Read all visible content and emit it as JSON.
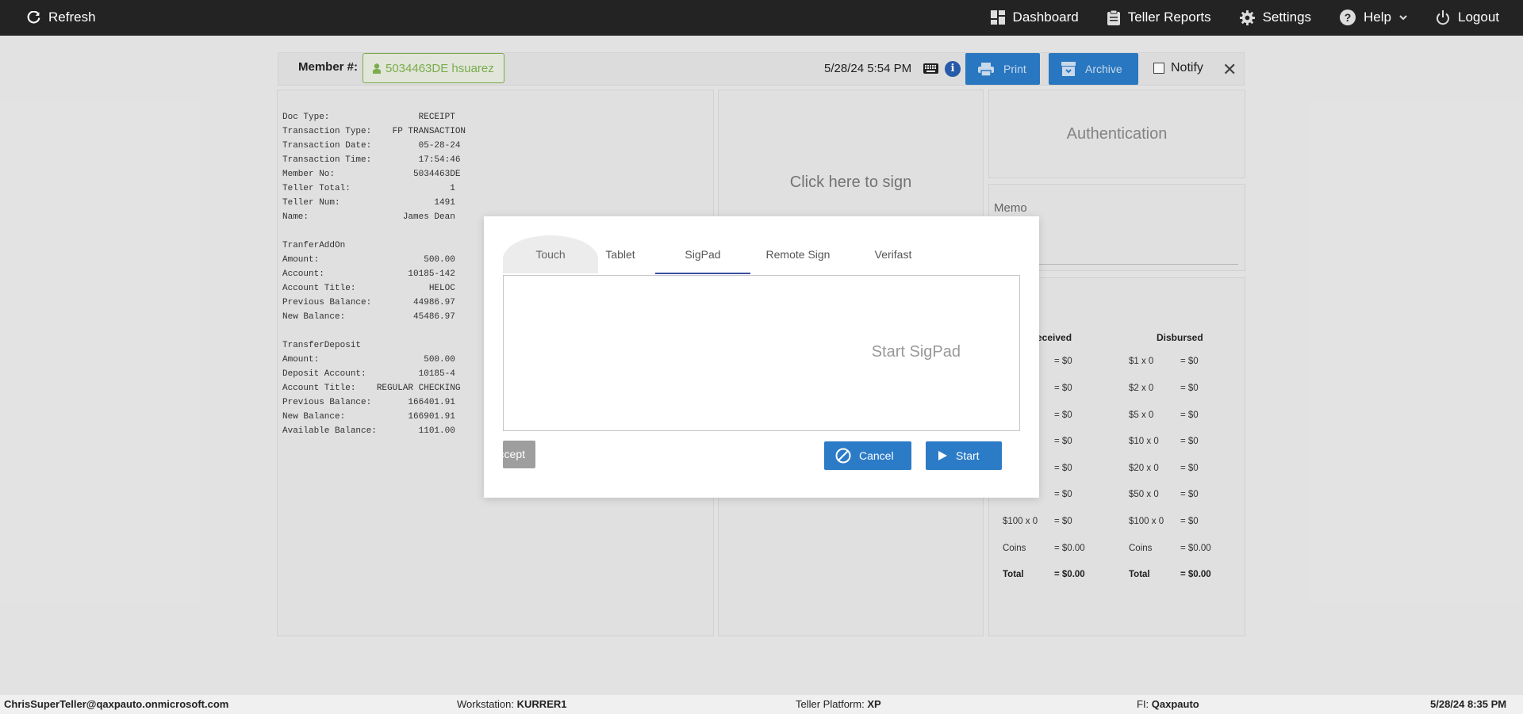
{
  "topbar": {
    "refresh_label": "Refresh",
    "nav": [
      {
        "label": "Dashboard",
        "icon": "dashboard-icon"
      },
      {
        "label": "Teller Reports",
        "icon": "clipboard-icon"
      },
      {
        "label": "Settings",
        "icon": "gear-icon"
      },
      {
        "label": "Help",
        "icon": "help-icon"
      },
      {
        "label": "Logout",
        "icon": "power-icon"
      }
    ]
  },
  "memberbar": {
    "label": "Member #:",
    "member": "5034463DE hsuarez",
    "datetime": "5/28/24 5:54 PM",
    "print_label": "Print",
    "archive_label": "Archive",
    "notify_label": "Notify"
  },
  "receipt": {
    "lines": [
      "Doc Type:                 RECEIPT",
      "Transaction Type:    FP TRANSACTION",
      "Transaction Date:         05-28-24",
      "Transaction Time:         17:54:46",
      "Member No:               5034463DE",
      "Teller Total:                   1",
      "Teller Num:                  1491",
      "Name:                  James Dean",
      "",
      "TranferAddOn",
      "Amount:                    500.00",
      "Account:                10185-142",
      "Account Title:              HELOC",
      "Previous Balance:        44986.97",
      "New Balance:             45486.97",
      "",
      "TransferDeposit",
      "Amount:                    500.00",
      "Deposit Account:          10185-4",
      "Account Title:    REGULAR CHECKING",
      "Previous Balance:       166401.91",
      "New Balance:            166901.91",
      "Available Balance:        1101.00"
    ]
  },
  "sign_panel": {
    "hint": "Click here to sign"
  },
  "auth": {
    "title": "Authentication"
  },
  "memo": {
    "label": "Memo"
  },
  "cash": {
    "received_header": "eceived",
    "disbursed_header": "Disbursed",
    "received": [
      {
        "denom": "",
        "total": "= $0"
      },
      {
        "denom": "",
        "total": "= $0"
      },
      {
        "denom": "",
        "total": "= $0"
      },
      {
        "denom": "",
        "total": "= $0"
      },
      {
        "denom": "",
        "total": "= $0"
      },
      {
        "denom": "",
        "total": "= $0"
      },
      {
        "denom": "$100 x 0",
        "total": "= $0"
      },
      {
        "denom": "Coins",
        "total": "= $0.00"
      },
      {
        "denom": "Total",
        "total": "= $0.00"
      }
    ],
    "disbursed": [
      {
        "denom": "$1 x 0",
        "total": "= $0"
      },
      {
        "denom": "$2 x 0",
        "total": "= $0"
      },
      {
        "denom": "$5 x 0",
        "total": "= $0"
      },
      {
        "denom": "$10 x 0",
        "total": "= $0"
      },
      {
        "denom": "$20 x 0",
        "total": "= $0"
      },
      {
        "denom": "$50 x 0",
        "total": "= $0"
      },
      {
        "denom": "$100 x 0",
        "total": "= $0"
      },
      {
        "denom": "Coins",
        "total": "= $0.00"
      },
      {
        "denom": "Total",
        "total": "= $0.00"
      }
    ]
  },
  "modal": {
    "tabs": [
      "Touch",
      "Tablet",
      "SigPad",
      "Remote Sign",
      "Verifast"
    ],
    "active_tab": "SigPad",
    "sigbox_hint": "Start SigPad",
    "accept_label": "ccept",
    "cancel_label": "Cancel",
    "start_label": "Start"
  },
  "status": {
    "user": "ChrisSuperTeller@qaxpauto.onmicrosoft.com",
    "workstation_label": "Workstation:",
    "workstation": "KURRER1",
    "platform_label": "Teller Platform:",
    "platform": "XP",
    "fi_label": "FI:",
    "fi": "Qaxpauto",
    "datetime": "5/28/24 8:35 PM"
  }
}
